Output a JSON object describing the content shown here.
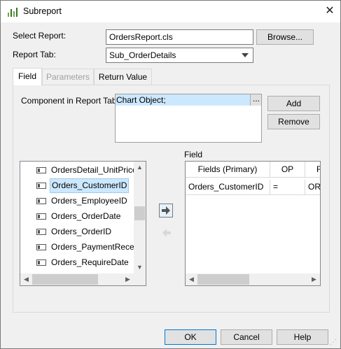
{
  "window": {
    "title": "Subreport",
    "app_icon": "chart-bars-icon",
    "close_glyph": "✕"
  },
  "select_report": {
    "label": "Select Report:",
    "value": "OrdersReport.cls",
    "browse_label": "Browse..."
  },
  "report_tab": {
    "label": "Report Tab:",
    "value": "Sub_OrderDetails"
  },
  "tabs": [
    {
      "label": "Field",
      "state": "active"
    },
    {
      "label": "Parameters",
      "state": "disabled"
    },
    {
      "label": "Return Value",
      "state": "normal"
    }
  ],
  "component": {
    "label": "Component in Report Tab:",
    "value": "Chart Object;",
    "ellipsis": "...",
    "add_label": "Add",
    "remove_label": "Remove"
  },
  "field_list": {
    "items": [
      "OrdersDetail_UnitPrice",
      "Orders_CustomerID",
      "Orders_EmployeeID",
      "Orders_OrderDate",
      "Orders_OrderID",
      "Orders_PaymentReceive",
      "Orders_RequireDate"
    ],
    "selected_index": 1
  },
  "field_grid": {
    "title": "Field",
    "columns": [
      "Fields (Primary)",
      "OP",
      "F"
    ],
    "rows": [
      [
        "Orders_CustomerID",
        "=",
        "ORI"
      ]
    ]
  },
  "footer": {
    "ok_label": "OK",
    "cancel_label": "Cancel",
    "help_label": "Help"
  },
  "colors": {
    "selection": "#cce8ff",
    "accent": "#0078d7",
    "titlebar": "#ffffff"
  }
}
